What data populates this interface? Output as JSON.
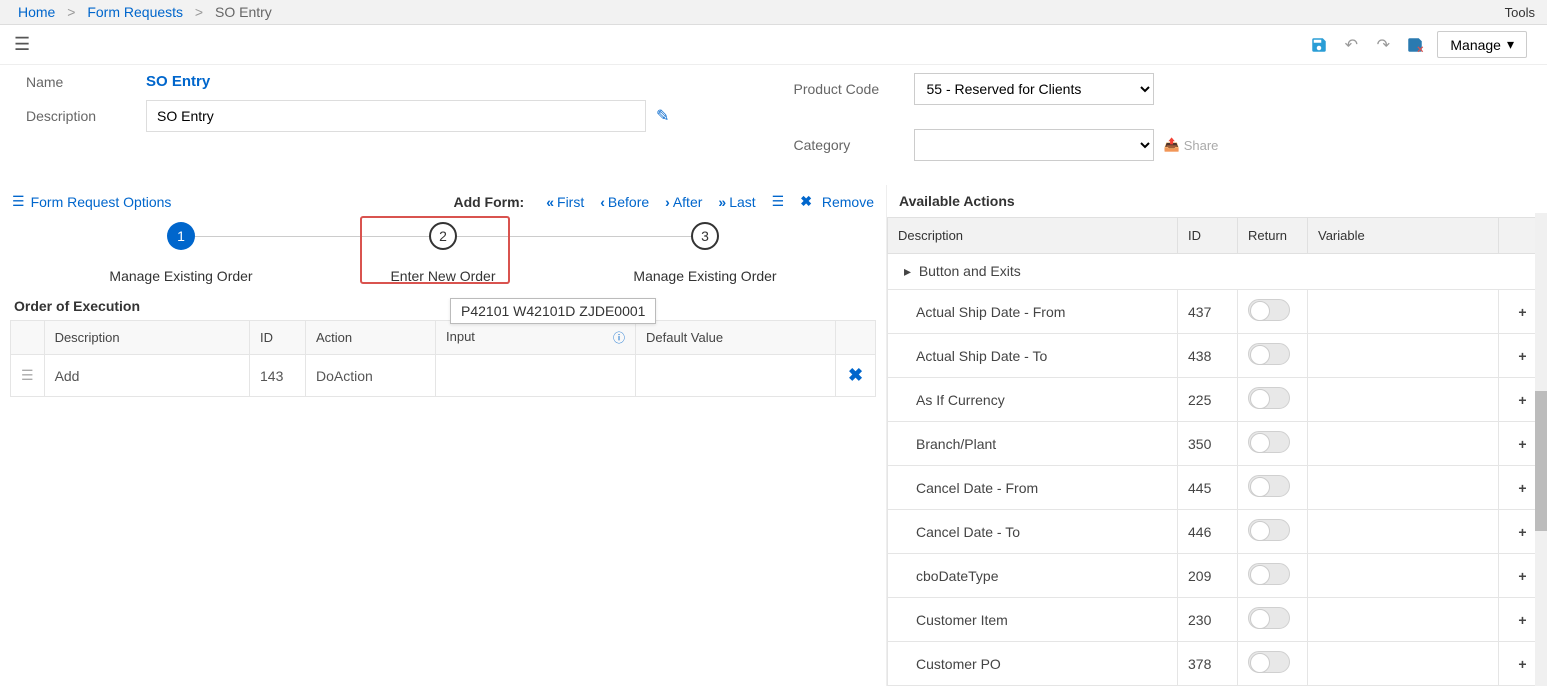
{
  "breadcrumb": {
    "home": "Home",
    "form_requests": "Form Requests",
    "current": "SO Entry"
  },
  "tools": "Tools",
  "toolbar": {
    "manage": "Manage"
  },
  "header": {
    "name_label": "Name",
    "name_value": "SO Entry",
    "desc_label": "Description",
    "desc_value": "SO Entry",
    "product_code_label": "Product Code",
    "product_code_value": "55 - Reserved for Clients",
    "category_label": "Category",
    "category_value": "",
    "share": "Share"
  },
  "options_title": "Form Request Options",
  "add_form": {
    "label": "Add Form:",
    "first": "First",
    "before": "Before",
    "after": "After",
    "last": "Last",
    "remove": "Remove"
  },
  "steps": [
    {
      "num": "1",
      "label": "Manage Existing Order"
    },
    {
      "num": "2",
      "label": "Enter New Order"
    },
    {
      "num": "3",
      "label": "Manage Existing Order"
    }
  ],
  "tooltip": "P42101 W42101D ZJDE0001",
  "exec_title": "Order of Execution",
  "exec_headers": {
    "desc": "Description",
    "id": "ID",
    "action": "Action",
    "input": "Input",
    "default": "Default Value"
  },
  "exec_rows": [
    {
      "desc": "Add",
      "id": "143",
      "action": "DoAction",
      "input": "",
      "default": ""
    }
  ],
  "actions_title": "Available Actions",
  "actions_headers": {
    "desc": "Description",
    "id": "ID",
    "return": "Return",
    "variable": "Variable"
  },
  "actions_group": "Button and Exits",
  "actions_rows": [
    {
      "desc": "Actual Ship Date - From",
      "id": "437"
    },
    {
      "desc": "Actual Ship Date - To",
      "id": "438"
    },
    {
      "desc": "As If Currency",
      "id": "225"
    },
    {
      "desc": "Branch/Plant",
      "id": "350"
    },
    {
      "desc": "Cancel Date - From",
      "id": "445"
    },
    {
      "desc": "Cancel Date - To",
      "id": "446"
    },
    {
      "desc": "cboDateType",
      "id": "209"
    },
    {
      "desc": "Customer Item",
      "id": "230"
    },
    {
      "desc": "Customer PO",
      "id": "378"
    }
  ]
}
